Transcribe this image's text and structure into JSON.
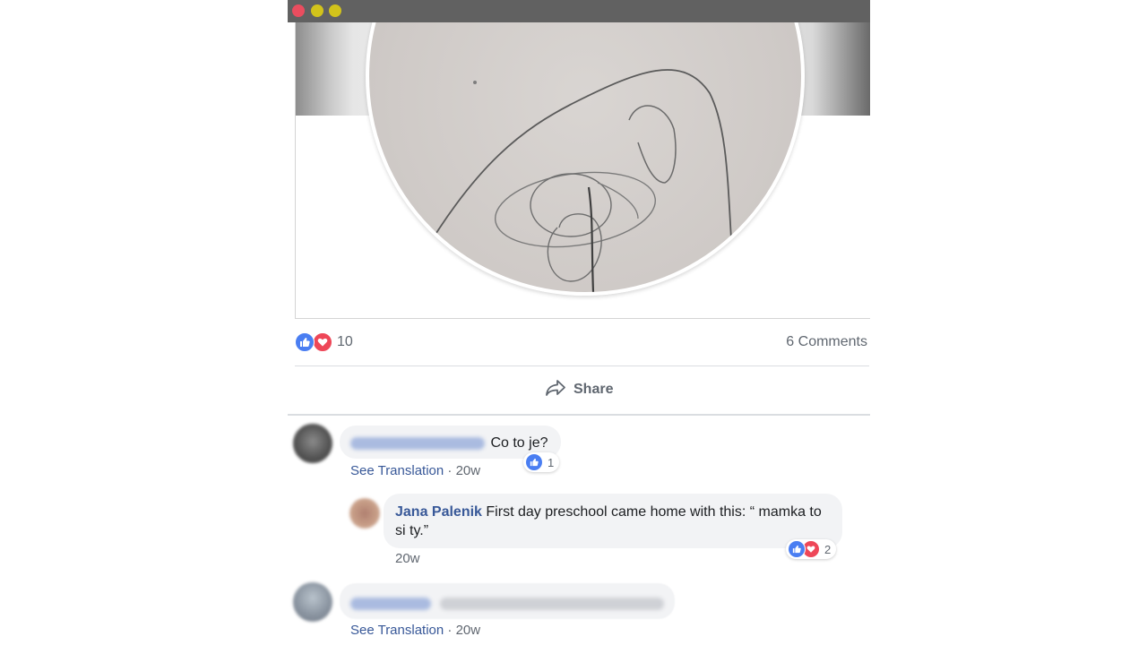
{
  "window": {
    "controls": [
      "close",
      "minimize",
      "maximize"
    ]
  },
  "post": {
    "reaction_count": "10",
    "comments_count": "6 Comments",
    "share_label": "Share",
    "reaction_types": [
      "like-icon",
      "love-icon"
    ]
  },
  "comments": [
    {
      "author": "",
      "text": "Co to je?",
      "translate_label": "See Translation",
      "time": "20w",
      "reactions": "1"
    },
    {
      "author": "Jana Palenik",
      "text": "First day preschool came home with this: “ mamka to si ty.”",
      "time": "20w",
      "reactions": "2"
    },
    {
      "author": "",
      "text": "",
      "translate_label": "See Translation",
      "time": "20w"
    }
  ],
  "colors": {
    "like": "#4a7ef2",
    "love": "#ee4758",
    "link": "#385898",
    "bubble": "#f2f3f5"
  }
}
